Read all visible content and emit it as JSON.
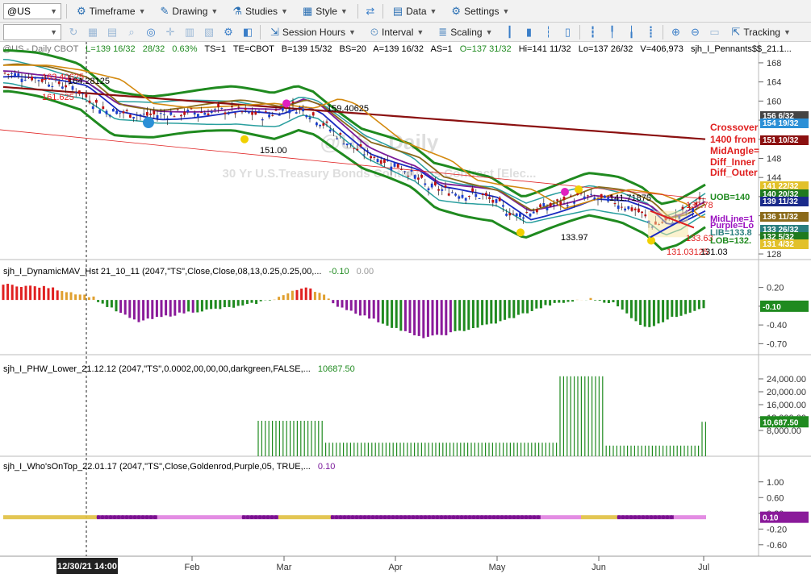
{
  "toolbar": {
    "symbol": "@US",
    "timeframe": "Timeframe",
    "drawing": "Drawing",
    "studies": "Studies",
    "style": "Style",
    "data": "Data",
    "settings": "Settings",
    "session_hours": "Session Hours",
    "interval": "Interval",
    "scaling": "Scaling",
    "tracking": "Tracking"
  },
  "header": {
    "symbol_line": "@US - Daily  CBOT",
    "L": "L=139 16/32",
    "chg": "28/32",
    "pct": "0.63%",
    "ts": "TS=1",
    "te": "TE=CBOT",
    "b": "B=139 15/32",
    "bs": "BS=20",
    "a": "A=139 16/32",
    "as": "AS=1",
    "o": "O=137 31/32",
    "hi": "Hi=141 11/32",
    "lo": "Lo=137 26/32",
    "v": "V=406,973",
    "study": "sjh_I_Pennants$$_21.1..."
  },
  "watermark": {
    "line1": "@US - Daily",
    "line2": "30 Yr U.S.Treasury Bonds Continuous Contract [Elec..."
  },
  "price_panel": {
    "ticks": [
      "168",
      "164",
      "160",
      "156",
      "152",
      "148",
      "144",
      "140",
      "136",
      "132",
      "128"
    ],
    "annotations": {
      "a1": "163.40625",
      "a2": "164.28125",
      "a3": "161.625",
      "a4": "159.40625",
      "a5": "151.00",
      "a6": "141.71875",
      "a7": "133.97",
      "a8": "131.03125",
      "a9": "131.03",
      "a10": "133.63",
      "a11": "137.78"
    },
    "labels": {
      "crossover": "Crossover",
      "from": "1400 from",
      "midangle": "MidAngle=",
      "diff_inner": "Diff_Inner",
      "diff_outer": "Diff_Outer",
      "uob": "UOB=140",
      "mid_ob": "MidLine=1",
      "purple": "Purple=Lo",
      "lib": "LIB=133.8",
      "lob": "LOB=132."
    },
    "badges": [
      {
        "text": "156 6/32",
        "color": "#444444"
      },
      {
        "text": "154 19/32",
        "color": "#2b8fd6"
      },
      {
        "text": "151 10/32",
        "color": "#8b1010"
      },
      {
        "text": "141 22/32",
        "color": "#e2c12a"
      },
      {
        "text": "140 20/32",
        "color": "#1f7a1f"
      },
      {
        "text": "139 11/32",
        "color": "#1a2a8a"
      },
      {
        "text": "136 11/32",
        "color": "#8a6a1a"
      },
      {
        "text": "133 26/32",
        "color": "#2a7f7f"
      },
      {
        "text": "132 5/32",
        "color": "#1f7a1f"
      },
      {
        "text": "131 4/32",
        "color": "#e2c12a"
      }
    ]
  },
  "mav_panel": {
    "title": "sjh_I_DynamicMAV_Hst 21_10_11 (2047,\"TS\",Close,Close,08,13,0.25,0.25,00,...",
    "value": "-0.10",
    "value2": "0.00",
    "ticks": [
      "0.20",
      "-0.10",
      "-0.40",
      "-0.70"
    ],
    "badge": "-0.10"
  },
  "phw_panel": {
    "title": "sjh_I_PHW_Lower_21.12.12 (2047,\"TS\",0.0002,00,00,00,darkgreen,FALSE,...",
    "value": "10687.50",
    "ticks": [
      "24,000.00",
      "20,000.00",
      "16,000.00",
      "12,000.00",
      "8,000.00"
    ],
    "badge": "10,687.50"
  },
  "wot_panel": {
    "title": "sjh_I_Who'sOnTop_22.01.17 (2047,\"TS\",Close,Goldenrod,Purple,05, TRUE,...",
    "value": "0.10",
    "ticks": [
      "1.00",
      "0.60",
      "0.20",
      "-0.20",
      "-0.60"
    ],
    "badge": "0.10"
  },
  "time_axis": {
    "cursor_label": "12/30/21 14:00",
    "months": [
      "Feb",
      "Mar",
      "Apr",
      "May",
      "Jun",
      "Jul"
    ]
  }
}
